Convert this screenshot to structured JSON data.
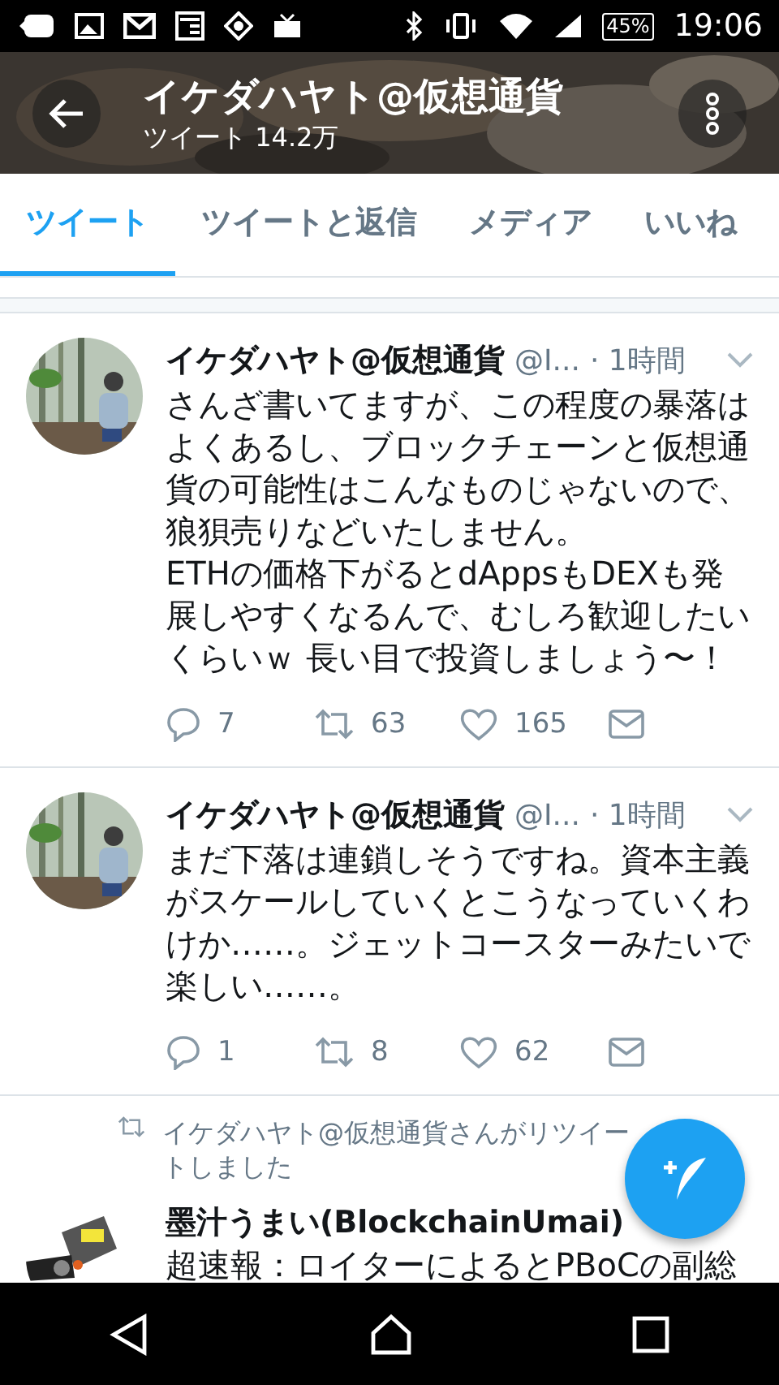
{
  "status_bar": {
    "battery": "45%",
    "time": "19:06"
  },
  "header": {
    "title": "イケダハヤト@仮想通貨",
    "subtitle": "ツイート 14.2万"
  },
  "tabs": [
    {
      "label": "ツイート",
      "selected": true
    },
    {
      "label": "ツイートと返信",
      "selected": false
    },
    {
      "label": "メディア",
      "selected": false
    },
    {
      "label": "いいね",
      "selected": false
    }
  ],
  "tweets": [
    {
      "kind": "tweet",
      "name": "イケダハヤト@仮想通貨",
      "handle": "@I...",
      "time": "· 1時間",
      "text": "さんざ書いてますが、この程度の暴落はよくあるし、ブロックチェーンと仮想通貨の可能性はこんなものじゃないので、狼狽売りなどいたしません。\nETHの価格下がるとdAppsもDEXも発展しやすくなるんで、むしろ歓迎したいくらいｗ 長い目で投資しましょう〜！",
      "replies": "7",
      "retweets": "63",
      "likes": "165"
    },
    {
      "kind": "tweet",
      "name": "イケダハヤト@仮想通貨",
      "handle": "@I...",
      "time": "· 1時間",
      "text": "まだ下落は連鎖しそうですね。資本主義がスケールしていくとこうなっていくわけか……。ジェットコースターみたいで楽しい……。",
      "replies": "1",
      "retweets": "8",
      "likes": "62"
    },
    {
      "kind": "retweet",
      "retweeted_by": "イケダハヤト@仮想通貨さんがリツイートしました",
      "name": "墨汁うまい(BlockchainUmai)",
      "text": "超速報：ロイターによるとPBoCの副総"
    }
  ]
}
